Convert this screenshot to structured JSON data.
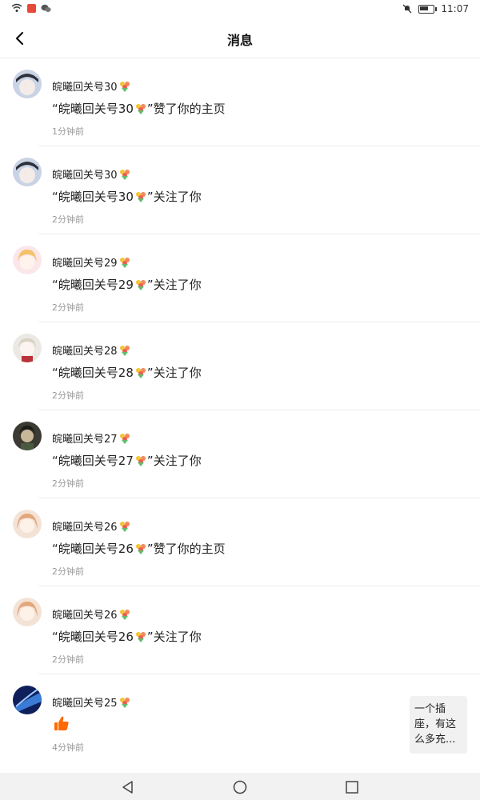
{
  "status_bar": {
    "time": "11:07",
    "icons": [
      "wifi-icon",
      "app-notification-icon",
      "wechat-icon",
      "mute-icon",
      "battery-icon"
    ]
  },
  "header": {
    "title": "消息",
    "back_icon": "chevron-left-icon"
  },
  "notifications": [
    {
      "name": "皖曦回关号30",
      "message_prefix": "“皖曦回关号30",
      "message_suffix": "”赞了你的主页",
      "time": "1分钟前"
    },
    {
      "name": "皖曦回关号30",
      "message_prefix": "“皖曦回关号30",
      "message_suffix": "”关注了你",
      "time": "2分钟前"
    },
    {
      "name": "皖曦回关号29",
      "message_prefix": "“皖曦回关号29",
      "message_suffix": "”关注了你",
      "time": "2分钟前"
    },
    {
      "name": "皖曦回关号28",
      "message_prefix": "“皖曦回关号28",
      "message_suffix": "”关注了你",
      "time": "2分钟前"
    },
    {
      "name": "皖曦回关号27",
      "message_prefix": "“皖曦回关号27",
      "message_suffix": "”关注了你",
      "time": "2分钟前"
    },
    {
      "name": "皖曦回关号26",
      "message_prefix": "“皖曦回关号26",
      "message_suffix": "”赞了你的主页",
      "time": "2分钟前"
    },
    {
      "name": "皖曦回关号26",
      "message_prefix": "“皖曦回关号26",
      "message_suffix": "”关注了你",
      "time": "2分钟前"
    },
    {
      "name": "皖曦回关号25",
      "message_icon": "thumbs-up-icon",
      "time": "4分钟前"
    }
  ],
  "floating_card": {
    "text": "一个插座，有这么多充..."
  },
  "nav_bar": {
    "icons": [
      "back-triangle-icon",
      "home-circle-icon",
      "recents-square-icon"
    ]
  },
  "colors": {
    "accent": "#ff6a00",
    "divider": "#eeeeee",
    "time_text": "#999999"
  }
}
